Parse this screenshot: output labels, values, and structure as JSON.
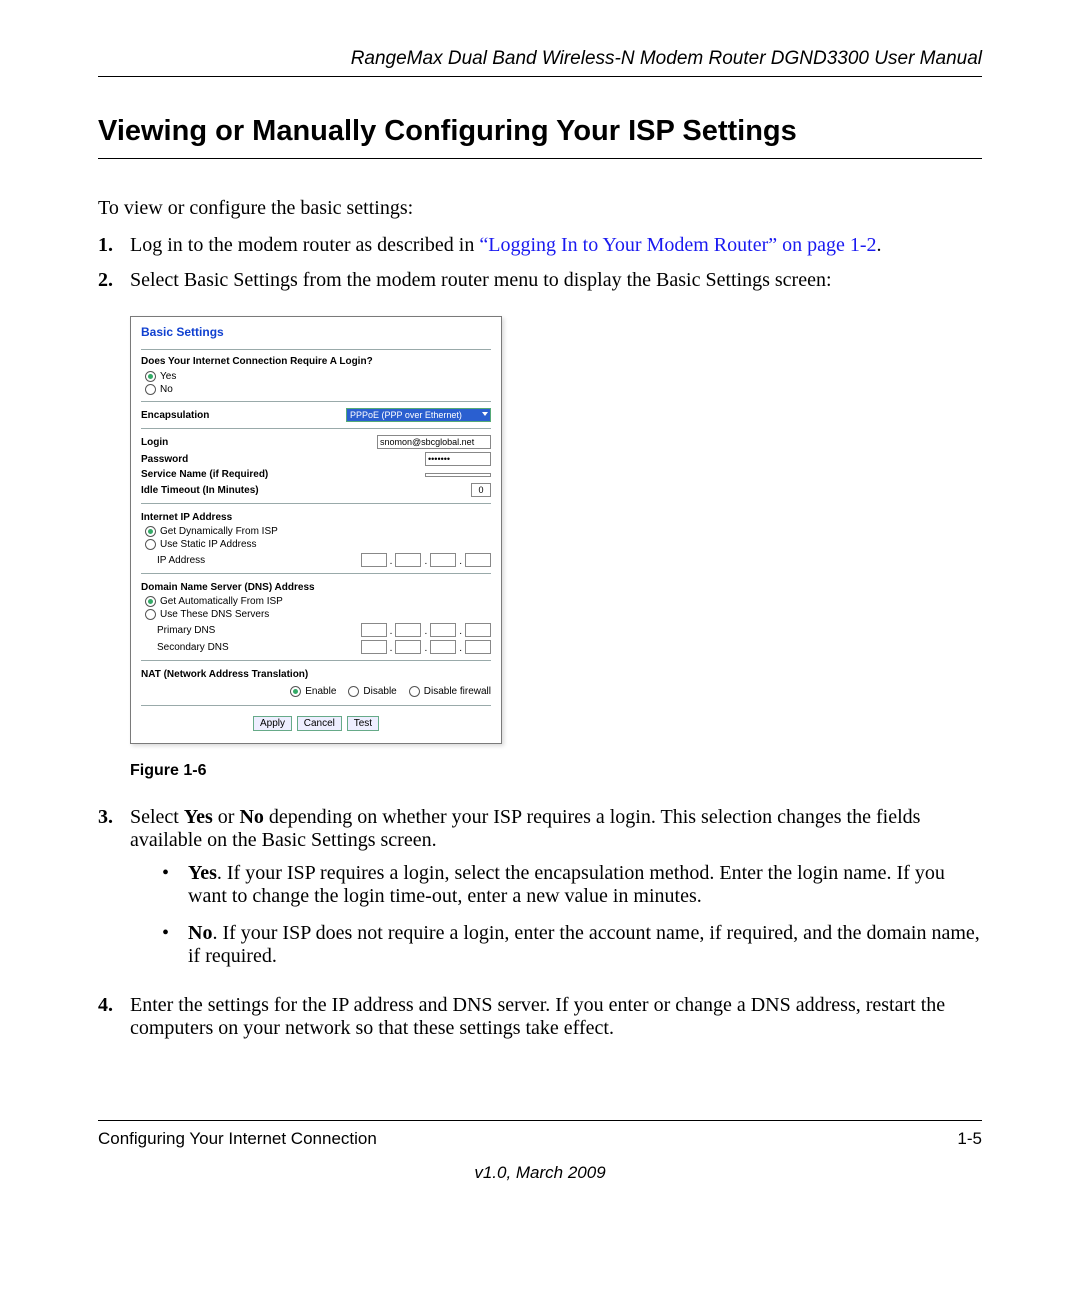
{
  "header": "RangeMax Dual Band Wireless-N Modem Router DGND3300 User Manual",
  "section_title": "Viewing or Manually Configuring Your ISP Settings",
  "intro": "To view or configure the basic settings:",
  "step1": {
    "num": "1.",
    "pre": "Log in to the modem router as described in ",
    "link": "“Logging In to Your Modem Router” on page 1-2",
    "post": "."
  },
  "step2": {
    "num": "2.",
    "text": "Select Basic Settings from the modem router menu to display the Basic Settings screen:"
  },
  "figure_caption": "Figure 1-6",
  "shot": {
    "title": "Basic Settings",
    "login_q": "Does Your Internet Connection Require A Login?",
    "yes": "Yes",
    "no": "No",
    "encap_label": "Encapsulation",
    "encap_value": "PPPoE (PPP over Ethernet)",
    "login_label": "Login",
    "login_value": "snomon@sbcglobal.net",
    "password_label": "Password",
    "password_value": "•••••••",
    "service_label": "Service Name (if Required)",
    "idle_label": "Idle Timeout (In Minutes)",
    "idle_value": "0",
    "ip_header": "Internet IP Address",
    "ip_dyn": "Get Dynamically From ISP",
    "ip_static": "Use Static IP Address",
    "ip_addr_label": "IP Address",
    "dns_header": "Domain Name Server (DNS) Address",
    "dns_auto": "Get Automatically From ISP",
    "dns_use": "Use These DNS Servers",
    "dns_primary": "Primary DNS",
    "dns_secondary": "Secondary DNS",
    "nat_header": "NAT (Network Address Translation)",
    "nat_enable": "Enable",
    "nat_disable": "Disable",
    "nat_disable_fw": "Disable firewall",
    "btn_apply": "Apply",
    "btn_cancel": "Cancel",
    "btn_test": "Test"
  },
  "step3": {
    "num": "3.",
    "pre": "Select ",
    "b1": "Yes",
    "mid1": " or ",
    "b2": "No",
    "post": " depending on whether your ISP requires a login. This selection changes the fields available on the Basic Settings screen."
  },
  "bullet_yes": {
    "b": "Yes",
    "text": ". If your ISP requires a login, select the encapsulation method. Enter the login name. If you want to change the login time-out, enter a new value in minutes."
  },
  "bullet_no": {
    "b": "No",
    "text": ". If your ISP does not require a login, enter the account name, if required, and the domain name, if required."
  },
  "step4": {
    "num": "4.",
    "text": "Enter the settings for the IP address and DNS server. If you enter or change a DNS address, restart the computers on your network so that these settings take effect."
  },
  "footer_left": "Configuring Your Internet Connection",
  "footer_right": "1-5",
  "version": "v1.0, March 2009"
}
